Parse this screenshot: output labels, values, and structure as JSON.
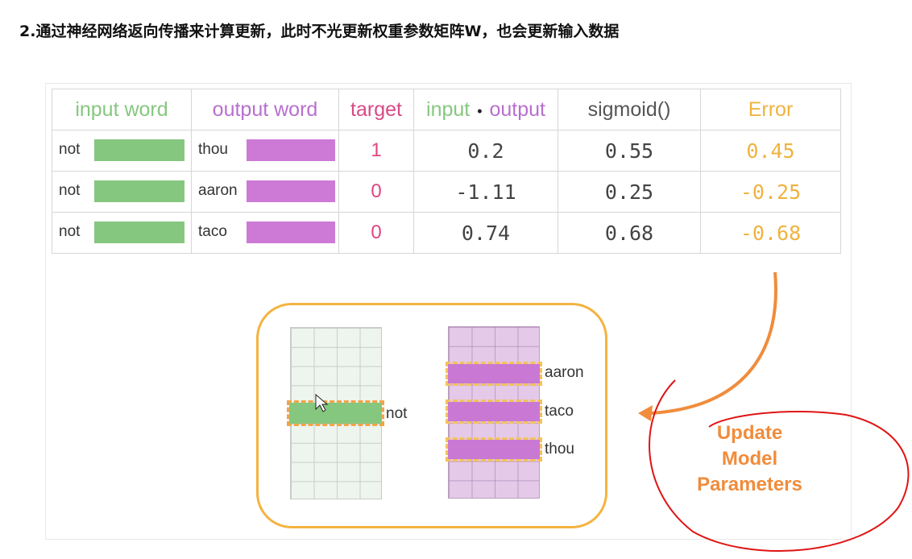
{
  "heading": "2.通过神经网络返向传播来计算更新，此时不光更新权重参数矩阵W，也会更新输入数据",
  "table": {
    "headers": {
      "input_word": "input word",
      "output_word": "output word",
      "target": "target",
      "dot_left": "input",
      "dot_symbol": "•",
      "dot_right": "output",
      "sigmoid": "sigmoid()",
      "error": "Error"
    },
    "rows": [
      {
        "input": "not",
        "output": "thou",
        "target": "1",
        "dot": "0.2",
        "sigmoid": "0.55",
        "error": "0.45"
      },
      {
        "input": "not",
        "output": "aaron",
        "target": "0",
        "dot": "-1.11",
        "sigmoid": "0.25",
        "error": "-0.25"
      },
      {
        "input": "not",
        "output": "taco",
        "target": "0",
        "dot": "0.74",
        "sigmoid": "0.68",
        "error": "-0.68"
      }
    ]
  },
  "diagram": {
    "input_label": "not",
    "output_labels": [
      "aaron",
      "taco",
      "thou"
    ],
    "update_text": [
      "Update",
      "Model",
      "Parameters"
    ]
  },
  "colors": {
    "input_green": "#86c77f",
    "output_purple": "#cd7ad6",
    "error_orange": "#efb33f",
    "arrow_orange": "#f08c3c",
    "annotation_red": "#e01414"
  }
}
